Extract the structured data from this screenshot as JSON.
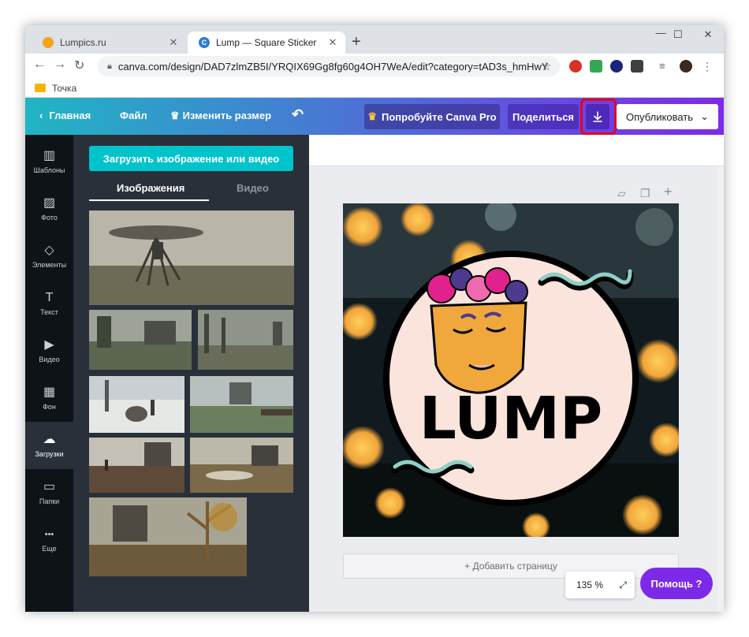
{
  "browser": {
    "tabs": [
      {
        "title": "Lumpics.ru",
        "favicon_color": "#f7a21b"
      },
      {
        "title": "Lump — Square Sticker",
        "favicon_color": "#2e7bd6",
        "favicon_letter": "C"
      }
    ],
    "new_tab": "+",
    "window_controls": {
      "minimize": "—",
      "maximize": "☐",
      "close": "✕"
    },
    "url": "canva.com/design/DAD7zlmZB5I/YRQIX69Gg8fg60g4OH7WeA/edit?category=tAD3s_hmHwY",
    "bookmark": "Точка"
  },
  "canva": {
    "header": {
      "home": "Главная",
      "file": "Файл",
      "resize": "Изменить размер",
      "try_pro": "Попробуйте Canva Pro",
      "share": "Поделиться",
      "publish": "Опубликовать"
    },
    "rail": [
      {
        "label": "Шаблоны",
        "icon": "▥"
      },
      {
        "label": "Фото",
        "icon": "▨"
      },
      {
        "label": "Элементы",
        "icon": "◇"
      },
      {
        "label": "Текст",
        "icon": "T"
      },
      {
        "label": "Видео",
        "icon": "▶"
      },
      {
        "label": "Фон",
        "icon": "▦"
      },
      {
        "label": "Загрузки",
        "icon": "☁"
      },
      {
        "label": "Папки",
        "icon": "▭"
      },
      {
        "label": "Еще",
        "icon": "•••"
      }
    ],
    "panel": {
      "upload_button": "Загрузить изображение или видео",
      "tab_images": "Изображения",
      "tab_video": "Видео"
    },
    "editor": {
      "add_page": "+ Добавить страницу",
      "zoom": "135 %",
      "help": "Помощь  ?"
    },
    "design": {
      "text": "LUMP"
    }
  }
}
